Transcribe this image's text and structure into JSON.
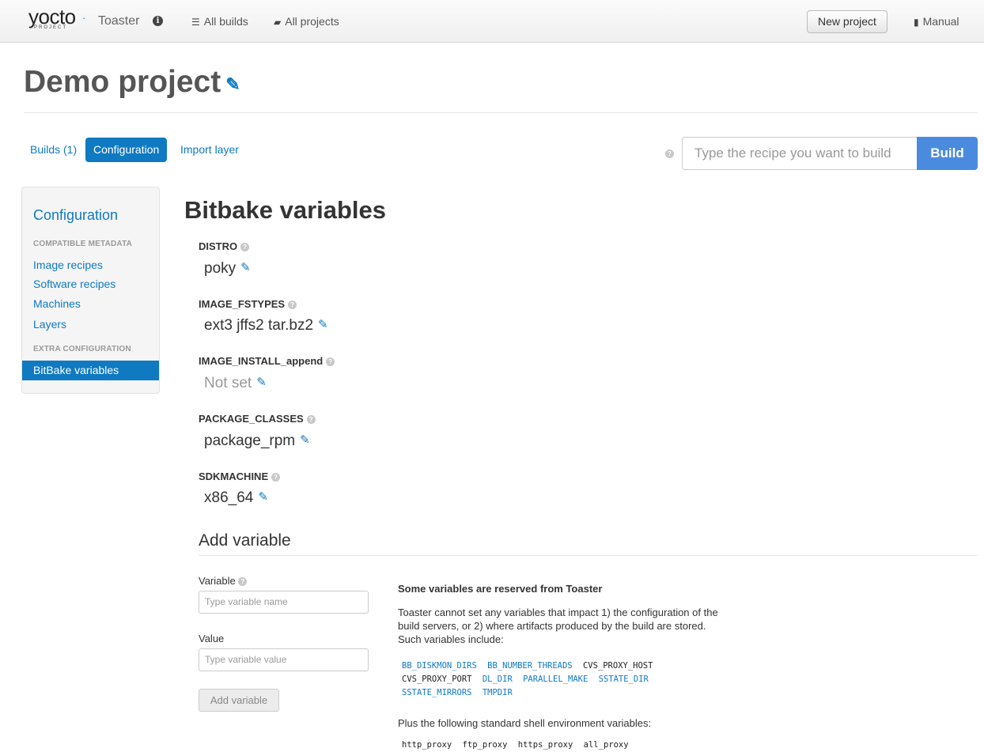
{
  "navbar": {
    "logo_text": "yocto",
    "logo_sub": "PROJECT",
    "app_name": "Toaster",
    "all_builds": "All builds",
    "all_projects": "All projects",
    "new_project": "New project",
    "manual": "Manual"
  },
  "page": {
    "title": "Demo project"
  },
  "tabs": {
    "builds": "Builds (1)",
    "configuration": "Configuration",
    "import_layer": "Import layer"
  },
  "build_form": {
    "placeholder": "Type the recipe you want to build",
    "button": "Build"
  },
  "sidebar": {
    "heading": "Configuration",
    "section_compatible": "COMPATIBLE METADATA",
    "items": [
      "Image recipes",
      "Software recipes",
      "Machines",
      "Layers"
    ],
    "section_extra": "EXTRA CONFIGURATION",
    "active_item": "BitBake variables"
  },
  "main": {
    "heading": "Bitbake variables",
    "variables": [
      {
        "name": "DISTRO",
        "value": "poky"
      },
      {
        "name": "IMAGE_FSTYPES",
        "value": "ext3 jffs2 tar.bz2"
      },
      {
        "name": "IMAGE_INSTALL_append",
        "value": "Not set"
      },
      {
        "name": "PACKAGE_CLASSES",
        "value": "package_rpm"
      },
      {
        "name": "SDKMACHINE",
        "value": "x86_64"
      }
    ]
  },
  "add_variable": {
    "heading": "Add variable",
    "variable_label": "Variable",
    "variable_placeholder": "Type variable name",
    "value_label": "Value",
    "value_placeholder": "Type variable value",
    "button": "Add variable"
  },
  "reserved": {
    "heading": "Some variables are reserved from Toaster",
    "description": "Toaster cannot set any variables that impact 1) the configuration of the build servers, or 2) where artifacts produced by the build are stored. Such variables include:",
    "vars": [
      {
        "name": "BB_DISKMON_DIRS",
        "link": true
      },
      {
        "name": "BB_NUMBER_THREADS",
        "link": true
      },
      {
        "name": "CVS_PROXY_HOST",
        "link": false
      },
      {
        "name": "CVS_PROXY_PORT",
        "link": false
      },
      {
        "name": "DL_DIR",
        "link": true
      },
      {
        "name": "PARALLEL_MAKE",
        "link": true
      },
      {
        "name": "SSTATE_DIR",
        "link": true
      },
      {
        "name": "SSTATE_MIRRORS",
        "link": true
      },
      {
        "name": "TMPDIR",
        "link": true
      }
    ],
    "shell_intro": "Plus the following standard shell environment variables:",
    "shell_vars": [
      "http_proxy",
      "ftp_proxy",
      "https_proxy",
      "all_proxy"
    ]
  },
  "colors": {
    "link": "#0f7ac1",
    "build_button": "#4a8be0"
  },
  "icons": {
    "info": "info-circle-icon",
    "builds": "list-icon",
    "projects": "folder-icon",
    "manual": "book-icon",
    "edit": "pencil-icon",
    "help": "question-circle-icon"
  }
}
